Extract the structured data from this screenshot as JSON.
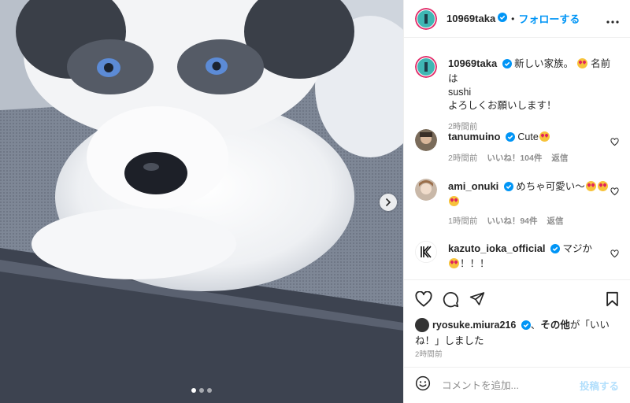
{
  "post": {
    "author": "10969taka",
    "follow_label": "フォローする",
    "separator": "•",
    "caption_line1": "新しい家族。",
    "caption_line1b": "名前は",
    "caption_line2": "sushi",
    "caption_line3": "よろしくお願いします！",
    "caption_time": "2時間前"
  },
  "comments": [
    {
      "user": "tanumuino",
      "text": "Cute",
      "time": "2時間前",
      "likes": "いいね！104件",
      "reply": "返信",
      "avatar_color": "#7a6b5a"
    },
    {
      "user": "ami_onuki",
      "text": "めちゃ可愛い〜",
      "time": "1時間前",
      "likes": "いいね！94件",
      "reply": "返信",
      "avatar_color": "#c9b8a8"
    },
    {
      "user": "kazuto_ioka_official",
      "text": "マジか",
      "text2": "！！！",
      "avatar_color": "#ffffff"
    }
  ],
  "likes": {
    "user": "ryosuke.miura216",
    "sep": "、",
    "others": "その他",
    "tail1": "が「いいね！」しました"
  },
  "post_time": "2時間前",
  "add_comment": {
    "placeholder": "コメントを追加...",
    "post_label": "投稿する"
  },
  "icons": {
    "verified": "verified-badge-icon",
    "more": "more-options-icon",
    "heart": "heart-icon",
    "comment": "comment-icon",
    "share": "share-icon",
    "save": "bookmark-icon",
    "emoji": "emoji-icon",
    "next": "chevron-right-icon"
  },
  "colors": {
    "link": "#0095f6",
    "verified": "#0095f6",
    "muted": "#8e8e8e",
    "text": "#262626"
  },
  "carousel": {
    "count": 3,
    "active": 1
  }
}
